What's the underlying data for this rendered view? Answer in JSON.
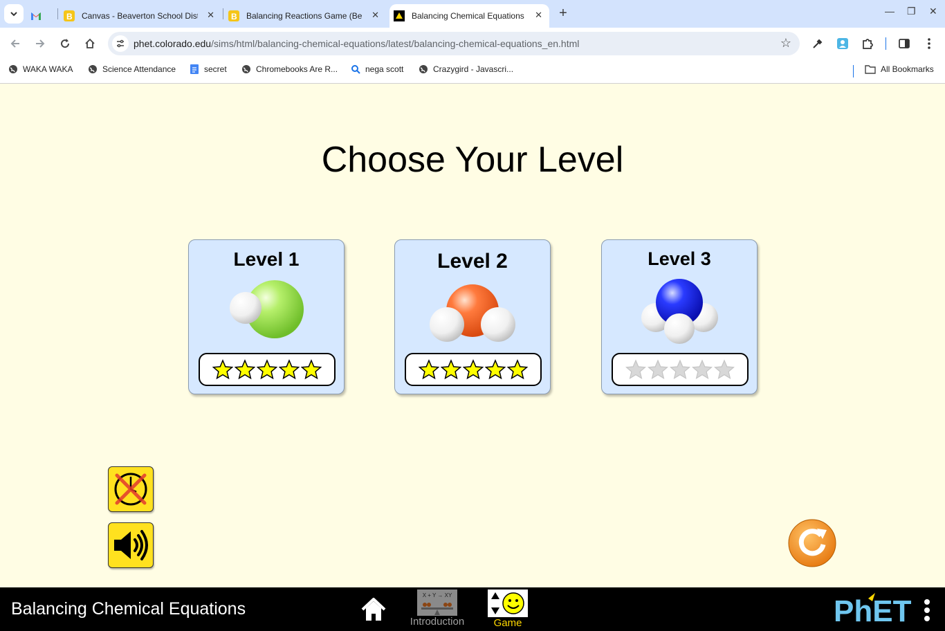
{
  "browser": {
    "tabs": [
      {
        "title": "",
        "icon": "gmail-icon"
      },
      {
        "title": "Canvas - Beaverton School Dist",
        "icon": "canvas-icon"
      },
      {
        "title": "Balancing Reactions Game (Be",
        "icon": "canvas-icon"
      },
      {
        "title": "Balancing Chemical Equations",
        "icon": "phet-icon",
        "active": true
      }
    ],
    "url_host": "phet.colorado.edu",
    "url_path": "/sims/html/balancing-chemical-equations/latest/balancing-chemical-equations_en.html",
    "bookmarks": [
      {
        "label": "WAKA WAKA",
        "icon": "globe-icon"
      },
      {
        "label": "Science Attendance",
        "icon": "globe-icon"
      },
      {
        "label": "secret",
        "icon": "docs-icon"
      },
      {
        "label": "Chromebooks Are R...",
        "icon": "globe-icon"
      },
      {
        "label": "nega scott",
        "icon": "search-icon"
      },
      {
        "label": "Crazygird - Javascri...",
        "icon": "globe-icon"
      }
    ],
    "all_bookmarks": "All Bookmarks"
  },
  "sim": {
    "heading": "Choose Your Level",
    "levels": [
      {
        "label": "Level 1",
        "stars_earned": 5,
        "stars_total": 5,
        "molecule": "HCl"
      },
      {
        "label": "Level 2",
        "stars_earned": 5,
        "stars_total": 5,
        "molecule": "H2O"
      },
      {
        "label": "Level 3",
        "stars_earned": 0,
        "stars_total": 5,
        "molecule": "NH3"
      }
    ],
    "timer_enabled": false,
    "sound_enabled": true
  },
  "navbar": {
    "title": "Balancing Chemical Equations",
    "screens": [
      {
        "label": "Introduction",
        "icon_text": "X + Y → XY",
        "selected": false
      },
      {
        "label": "Game",
        "selected": true
      }
    ],
    "logo": "PhET"
  },
  "colors": {
    "background": "#fffde4",
    "card": "#d6e8ff",
    "star_filled": "#ffff00",
    "star_empty": "#d8d8d8",
    "button_yellow": "#ffe11f",
    "reset_orange": "#f7941d",
    "game_label": "#ffd800",
    "intro_label": "#a0a0a0"
  }
}
